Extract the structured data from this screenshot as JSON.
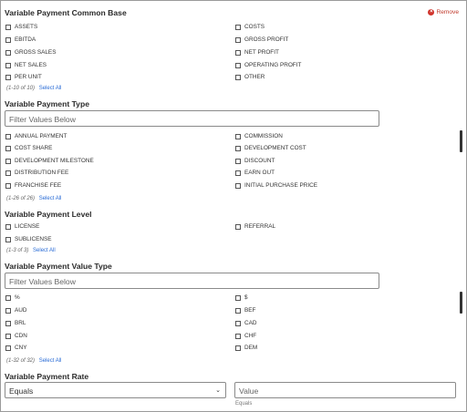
{
  "common_base": {
    "title": "Variable Payment Common Base",
    "remove_label": "Remove",
    "left": [
      "ASSETS",
      "EBITDA",
      "GROSS SALES",
      "NET SALES",
      "PER UNIT"
    ],
    "right": [
      "COSTS",
      "GROSS PROFIT",
      "NET PROFIT",
      "OPERATING PROFIT",
      "OTHER"
    ],
    "count": "(1-10 of 10)",
    "select_all": "Select All"
  },
  "payment_type": {
    "title": "Variable Payment Type",
    "placeholder": "Filter Values Below",
    "left": [
      "ANNUAL PAYMENT",
      "COST SHARE",
      "DEVELOPMENT MILESTONE",
      "DISTRIBUTION FEE",
      "FRANCHISE FEE"
    ],
    "right": [
      "COMMISSION",
      "DEVELOPMENT COST",
      "DISCOUNT",
      "EARN OUT",
      "INITIAL PURCHASE PRICE"
    ],
    "count": "(1-26 of 26)",
    "select_all": "Select All"
  },
  "payment_level": {
    "title": "Variable Payment Level",
    "left": [
      "LICENSE",
      "SUBLICENSE"
    ],
    "right": [
      "REFERRAL"
    ],
    "count": "(1-3 of 3)",
    "select_all": "Select All"
  },
  "value_type": {
    "title": "Variable Payment Value Type",
    "placeholder": "Filter Values Below",
    "left": [
      "%",
      "AUD",
      "BRL",
      "CDN",
      "CNY"
    ],
    "right": [
      "$",
      "BEF",
      "CAD",
      "CHF",
      "DEM"
    ],
    "count": "(1-32 of 32)",
    "select_all": "Select All"
  },
  "payment_rate": {
    "title": "Variable Payment Rate",
    "operator": "Equals",
    "value_placeholder": "Value",
    "value_hint": "Equals"
  }
}
